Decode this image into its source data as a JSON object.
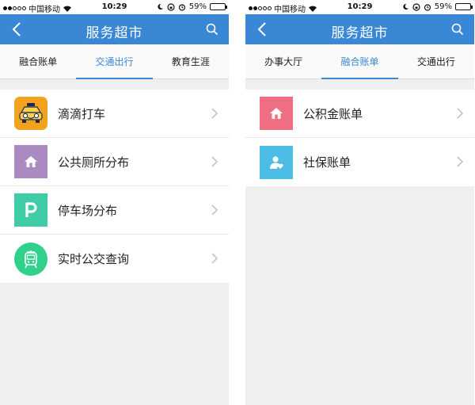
{
  "status": {
    "carrier": "中国移动",
    "time": "10:29",
    "battery": "59%",
    "battery_level": 0.59
  },
  "screens": [
    {
      "nav": {
        "title": "服务超市"
      },
      "tabs": [
        {
          "label": "融合账单",
          "active": false
        },
        {
          "label": "交通出行",
          "active": true
        },
        {
          "label": "教育生涯",
          "active": false
        }
      ],
      "items": [
        {
          "label": "滴滴打车",
          "icon": "taxi-icon",
          "color": "#f2a21f"
        },
        {
          "label": "公共厕所分布",
          "icon": "home-icon",
          "color": "#a98bc1"
        },
        {
          "label": "停车场分布",
          "icon": "parking-icon",
          "color": "#3fcca6"
        },
        {
          "label": "实时公交查询",
          "icon": "bus-icon",
          "color": "#31d08d"
        }
      ]
    },
    {
      "nav": {
        "title": "服务超市"
      },
      "tabs": [
        {
          "label": "办事大厅",
          "active": false
        },
        {
          "label": "融合账单",
          "active": true
        },
        {
          "label": "交通出行",
          "active": false
        }
      ],
      "items": [
        {
          "label": "公积金账单",
          "icon": "home-icon",
          "color": "#f06e82"
        },
        {
          "label": "社保账单",
          "icon": "person-heart-icon",
          "color": "#4dbde6"
        }
      ]
    }
  ],
  "colors": {
    "navbar": "#3a87d6",
    "active_tab": "#3a87d6",
    "background": "#efeff0"
  }
}
